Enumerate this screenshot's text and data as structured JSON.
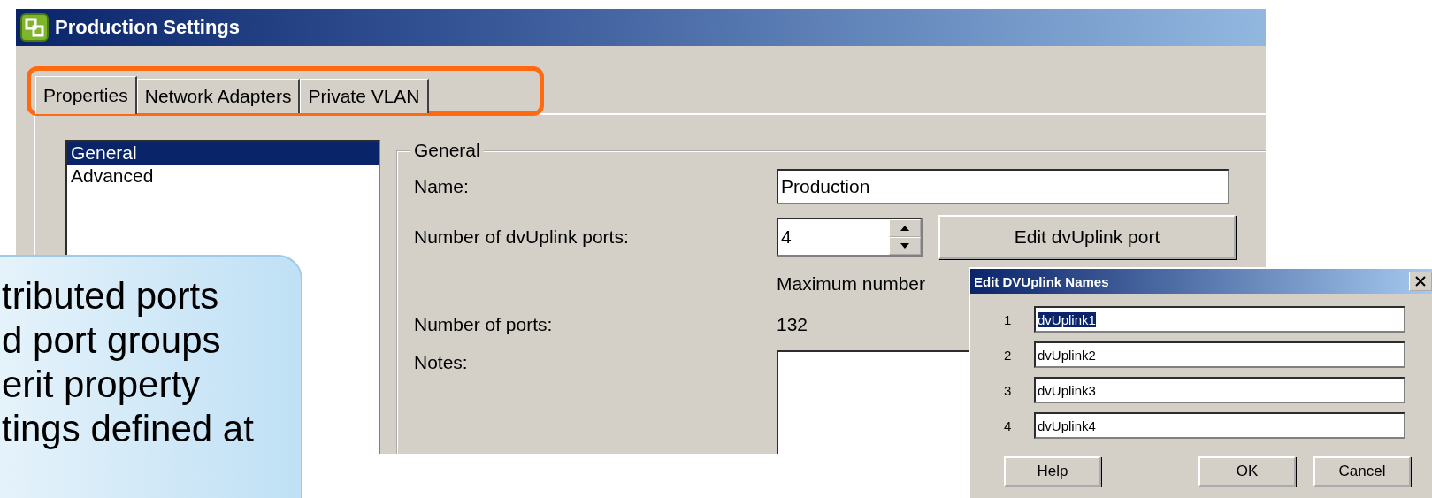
{
  "main_window": {
    "title": "Production Settings",
    "tabs": [
      {
        "label": "Properties",
        "selected": true
      },
      {
        "label": "Network Adapters",
        "selected": false
      },
      {
        "label": "Private VLAN",
        "selected": false
      }
    ],
    "sidebar": {
      "items": [
        {
          "label": "General",
          "selected": true
        },
        {
          "label": "Advanced",
          "selected": false
        }
      ]
    },
    "general": {
      "title": "General",
      "name_label": "Name:",
      "name_value": "Production",
      "uplink_label": "Number of dvUplink ports:",
      "uplink_value": "4",
      "edit_button": "Edit dvUplink port",
      "max_note": "Maximum number",
      "ports_label": "Number of ports:",
      "ports_value": "132",
      "notes_label": "Notes:"
    }
  },
  "callout": {
    "lines": [
      "tributed ports",
      "d port groups",
      "erit property",
      "tings defined at"
    ]
  },
  "dialog": {
    "title": "Edit DVUplink Names",
    "rows": [
      {
        "index": "1",
        "value": "dvUplink1",
        "selected": true
      },
      {
        "index": "2",
        "value": "dvUplink2",
        "selected": false
      },
      {
        "index": "3",
        "value": "dvUplink3",
        "selected": false
      },
      {
        "index": "4",
        "value": "dvUplink4",
        "selected": false
      }
    ],
    "buttons": [
      "Help",
      "OK",
      "Cancel"
    ]
  }
}
